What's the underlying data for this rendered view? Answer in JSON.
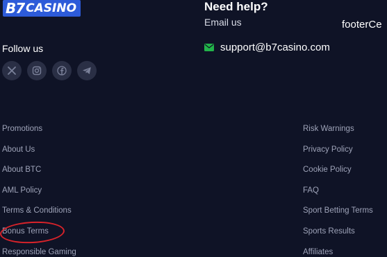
{
  "logo": {
    "mark": "B7",
    "text": "CASINO"
  },
  "follow": {
    "label": "Follow us",
    "socials": [
      {
        "icon": "x-icon"
      },
      {
        "icon": "instagram-icon"
      },
      {
        "icon": "facebook-icon"
      },
      {
        "icon": "telegram-icon"
      }
    ]
  },
  "help": {
    "title": "Need help?",
    "email_label": "Email us",
    "email_address": "support@b7casino.com",
    "overflow_text": "footerCe"
  },
  "links_left": [
    "Promotions",
    "About Us",
    "About BTC",
    "AML Policy",
    "Terms & Conditions",
    "Bonus Terms",
    "Responsible Gaming"
  ],
  "links_right": [
    "Risk Warnings",
    "Privacy Policy",
    "Cookie Policy",
    "FAQ",
    "Sport Betting Terms",
    "Sports Results",
    "Affiliates"
  ],
  "colors": {
    "background": "#0f1326",
    "link": "#9ea3b8",
    "accent_green": "#22b34a",
    "annotation_red": "#d8232a",
    "logo_blue": "#2d5bd9"
  }
}
